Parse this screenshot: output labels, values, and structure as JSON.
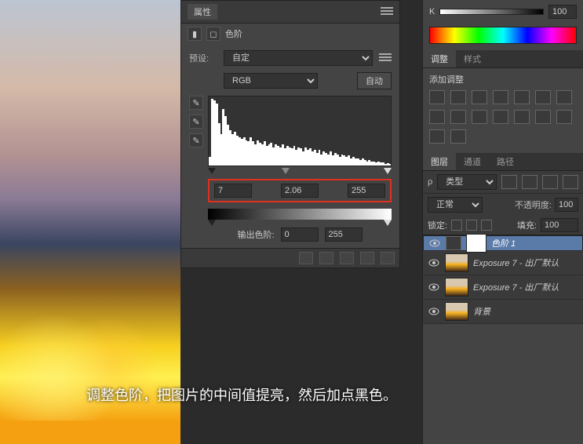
{
  "properties": {
    "panel_title": "属性",
    "adj_label": "色阶",
    "preset_label": "预设:",
    "preset_value": "自定",
    "channel_value": "RGB",
    "auto_label": "自动",
    "input_black": "7",
    "input_mid": "2.06",
    "input_white": "255",
    "output_label": "输出色阶:",
    "output_black": "0",
    "output_white": "255"
  },
  "color": {
    "k_label": "K",
    "k_value": "100"
  },
  "adjust_panel": {
    "tab_adjust": "调整",
    "tab_styles": "样式",
    "add_label": "添加调整"
  },
  "layers_panel": {
    "tab_layers": "图层",
    "tab_channels": "通道",
    "tab_paths": "路径",
    "kind_value": "类型",
    "blend_value": "正常",
    "opacity_label": "不透明度:",
    "opacity_value": "100",
    "lock_label": "锁定:",
    "fill_label": "填充:",
    "fill_value": "100",
    "items": [
      {
        "name": "色阶 1",
        "type": "levels",
        "selected": true
      },
      {
        "name": "Exposure 7 - 出厂默认",
        "type": "img",
        "selected": false
      },
      {
        "name": "Exposure 7 - 出厂默认",
        "type": "img",
        "selected": false
      },
      {
        "name": "背景",
        "type": "img",
        "selected": false
      }
    ]
  },
  "caption": "调整色阶，把图片的中间值提亮，然后加点黑色。",
  "chart_data": {
    "type": "bar",
    "title": "Histogram",
    "xlabel": "",
    "ylabel": "",
    "ylim": [
      0,
      100
    ],
    "values": [
      12,
      95,
      92,
      88,
      60,
      45,
      80,
      70,
      58,
      50,
      44,
      48,
      42,
      40,
      38,
      40,
      36,
      35,
      40,
      34,
      30,
      36,
      32,
      30,
      34,
      28,
      30,
      32,
      26,
      30,
      28,
      26,
      30,
      24,
      28,
      26,
      24,
      28,
      22,
      26,
      24,
      20,
      26,
      22,
      24,
      20,
      22,
      18,
      22,
      16,
      20,
      18,
      16,
      20,
      14,
      18,
      16,
      12,
      16,
      14,
      12,
      14,
      10,
      12,
      10,
      10,
      8,
      10,
      8,
      6,
      8,
      6,
      6,
      4,
      6,
      4,
      4,
      2,
      3,
      2
    ]
  }
}
